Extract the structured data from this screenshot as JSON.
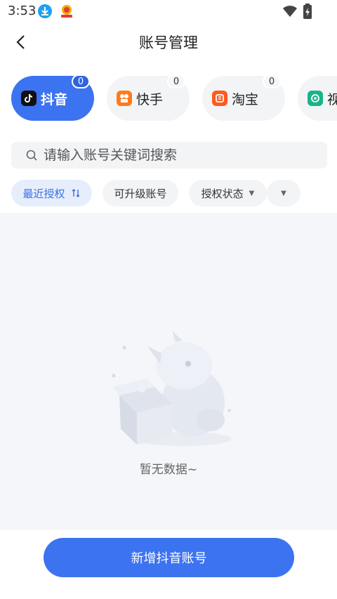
{
  "status_bar": {
    "time": "3:53"
  },
  "header": {
    "title": "账号管理"
  },
  "platform_tabs": [
    {
      "label": "抖音",
      "count": "0",
      "icon": "douyin-icon",
      "color": "#111111"
    },
    {
      "label": "快手",
      "count": "0",
      "icon": "kuaishou-icon",
      "color": "#ff7a1a"
    },
    {
      "label": "淘宝",
      "count": "0",
      "icon": "taobao-icon",
      "color": "#ff5a1f"
    },
    {
      "label": "视",
      "count": "",
      "icon": "shipin-icon",
      "color": "#19b38a"
    }
  ],
  "search": {
    "placeholder": "请输入账号关键词搜索"
  },
  "filters": [
    {
      "label": "最近授权",
      "icon": "sort-icon"
    },
    {
      "label": "可升级账号"
    },
    {
      "label": "授权状态",
      "icon": "caret-down-icon"
    },
    {
      "label": "",
      "icon": "caret-down-icon"
    }
  ],
  "empty_state": {
    "text": "暂无数据~"
  },
  "footer": {
    "button_label": "新增抖音账号"
  },
  "colors": {
    "primary": "#3c73f0",
    "background": "#f5f6fa"
  }
}
